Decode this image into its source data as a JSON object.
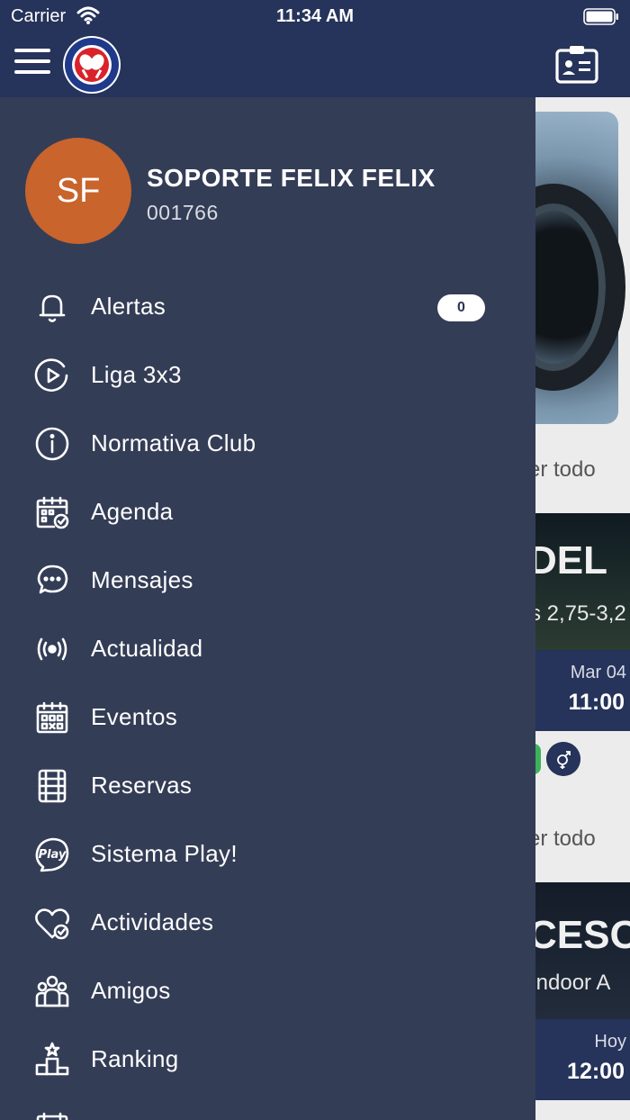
{
  "status_bar": {
    "carrier": "Carrier",
    "time": "11:34 AM"
  },
  "user": {
    "initials": "SF",
    "name": "SOPORTE FELIX FELIX",
    "id": "001766"
  },
  "menu": [
    {
      "label": "Alertas",
      "icon": "bell-icon",
      "badge": "0"
    },
    {
      "label": "Liga 3x3",
      "icon": "play-circle-icon"
    },
    {
      "label": "Normativa Club",
      "icon": "info-circle-icon"
    },
    {
      "label": "Agenda",
      "icon": "calendar-check-icon"
    },
    {
      "label": "Mensajes",
      "icon": "chat-bubble-icon"
    },
    {
      "label": "Actualidad",
      "icon": "broadcast-icon"
    },
    {
      "label": "Eventos",
      "icon": "calendar-grid-icon"
    },
    {
      "label": "Reservas",
      "icon": "court-icon"
    },
    {
      "label": "Sistema Play!",
      "icon": "play-logo-icon"
    },
    {
      "label": "Actividades",
      "icon": "heart-check-icon"
    },
    {
      "label": "Amigos",
      "icon": "group-icon"
    },
    {
      "label": "Ranking",
      "icon": "podium-icon"
    }
  ],
  "background_content": {
    "see_all_1": "er todo",
    "card1_title": "DEL",
    "card1_subtitle": "s 2,75-3,2",
    "card1_date": "Mar 04",
    "card1_time": "11:00",
    "see_all_2": "er todo",
    "card2_title": "CESO",
    "card2_subtitle": "Indoor A",
    "card2_date": "Hoy",
    "card2_time": "12:00"
  },
  "colors": {
    "header": "#26335a",
    "drawer": "#343d56",
    "avatar": "#c8642c",
    "badge_bg": "#ffffff"
  }
}
